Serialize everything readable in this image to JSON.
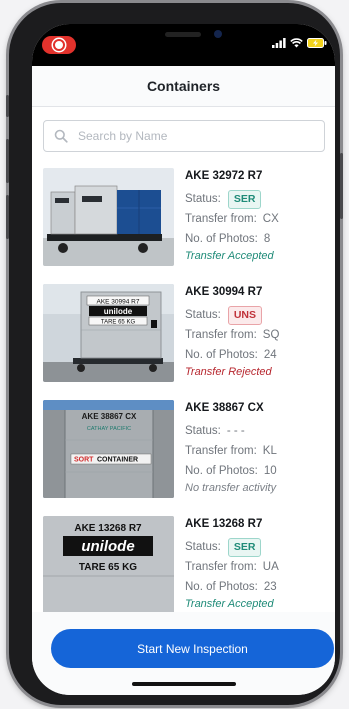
{
  "header": {
    "title": "Containers"
  },
  "search": {
    "placeholder": "Search by Name",
    "value": ""
  },
  "labels": {
    "status": "Status:",
    "transfer_from": "Transfer from:",
    "photos": "No. of Photos:"
  },
  "containers": [
    {
      "name": "AKE 32972 R7",
      "status": "SER",
      "transfer_from": "CX",
      "photos": "8",
      "transfer_status": "Transfer Accepted"
    },
    {
      "name": "AKE 30994 R7",
      "status": "UNS",
      "transfer_from": "SQ",
      "photos": "24",
      "transfer_status": "Transfer Rejected"
    },
    {
      "name": "AKE 38867 CX",
      "status": "- - -",
      "transfer_from": "KL",
      "photos": "10",
      "transfer_status": "No transfer activity"
    },
    {
      "name": "AKE 13268 R7",
      "status": "SER",
      "transfer_from": "UA",
      "photos": "23",
      "transfer_status": "Transfer Accepted"
    }
  ],
  "photo_text": {
    "c2_code": "AKE 30994 R7",
    "c2_brand": "unilode",
    "c2_tare": "TARE 65 KG",
    "c3_code": "AKE 38867 CX",
    "c3_airline": "CATHAY PACIFIC",
    "c3_sign_red": "SORT",
    "c3_sign_black": "CONTAINER",
    "c4_code": "AKE 13268 R7",
    "c4_brand": "unilode",
    "c4_tare": "TARE 65 KG"
  },
  "actions": {
    "start_inspection": "Start New Inspection"
  },
  "colors": {
    "primary": "#1565d8",
    "ser": "#1f8b78",
    "uns": "#c0323a"
  }
}
